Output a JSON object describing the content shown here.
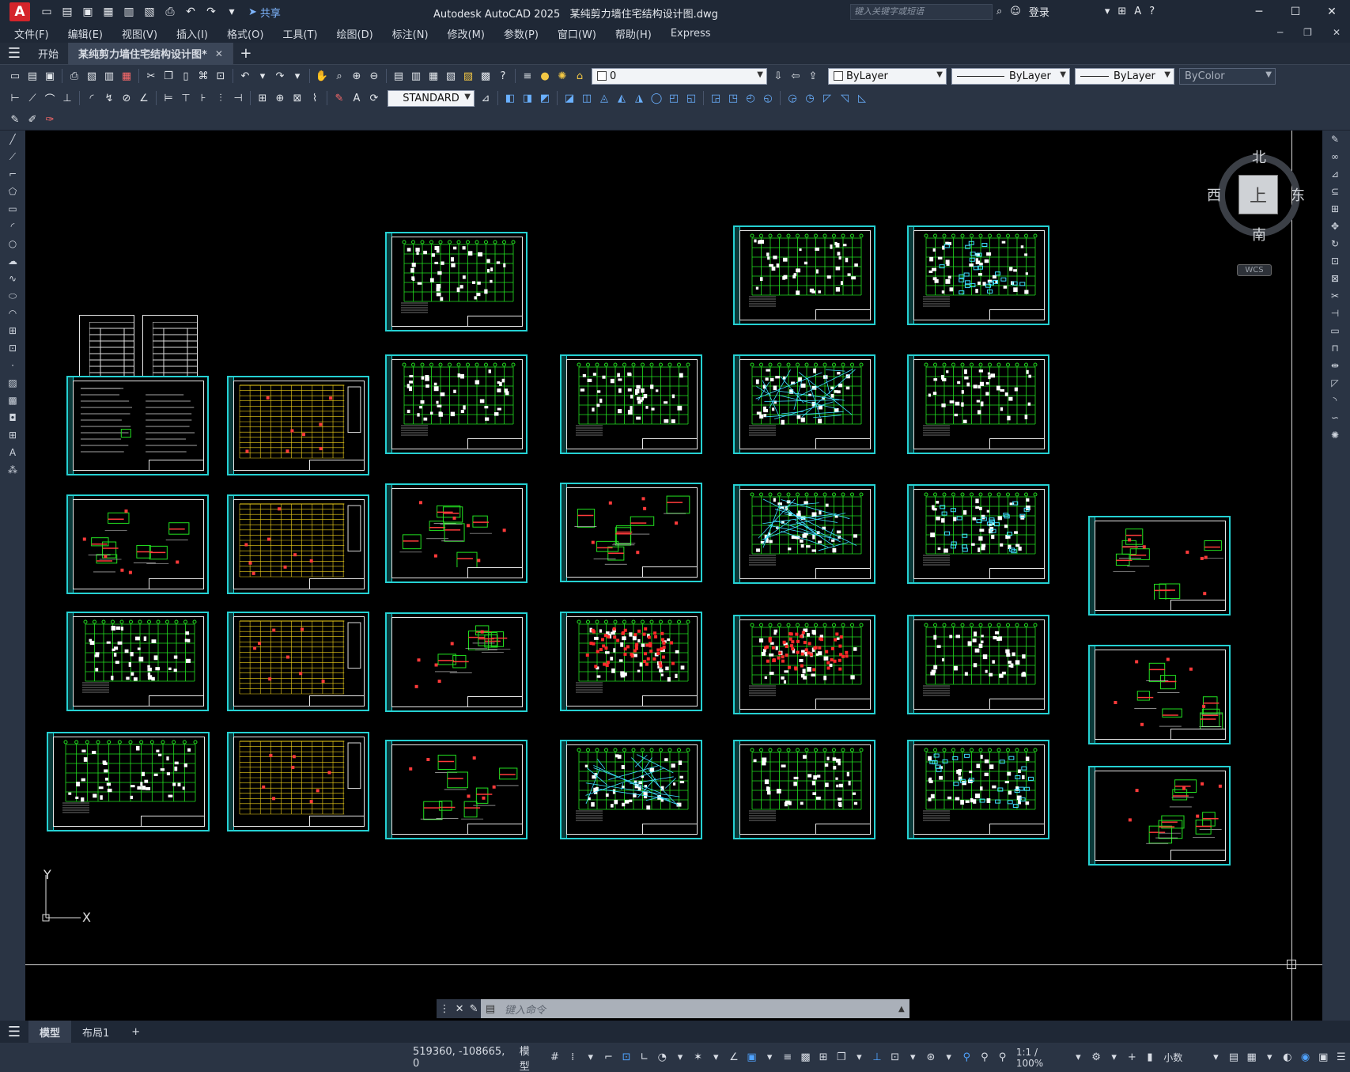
{
  "title": {
    "app": "Autodesk AutoCAD 2025",
    "file": "某纯剪力墙住宅结构设计图.dwg",
    "share": "共享",
    "search_placeholder": "键入关键字或短语",
    "login": "登录"
  },
  "menu": [
    "文件(F)",
    "编辑(E)",
    "视图(V)",
    "插入(I)",
    "格式(O)",
    "工具(T)",
    "绘图(D)",
    "标注(N)",
    "修改(M)",
    "参数(P)",
    "窗口(W)",
    "帮助(H)",
    "Express"
  ],
  "tabs": {
    "start": "开始",
    "document": "某纯剪力墙住宅结构设计图*"
  },
  "toolbar": {
    "layer_value": "0",
    "color_value": "ByLayer",
    "linetype_value": "ByLayer",
    "lineweight_value": "ByLayer",
    "plotstyle_value": "ByColor",
    "textstyle_value": "STANDARD"
  },
  "viewcube": {
    "north": "北",
    "south": "南",
    "east": "东",
    "west": "西",
    "face": "上",
    "wcs": "WCS"
  },
  "ucs": {
    "x": "X",
    "y": "Y"
  },
  "command": {
    "placeholder": "键入命令"
  },
  "layout_tabs": [
    "模型",
    "布局1"
  ],
  "status": {
    "coords": "519360, -108665, 0",
    "model": "模型",
    "scale": "1:1 / 100%",
    "units": "小数"
  },
  "colors": {
    "sheet_border": "#25d1d3",
    "drawing_green": "#22e020",
    "canvas_bg": "#000000",
    "ui_bg": "#2a3444"
  }
}
